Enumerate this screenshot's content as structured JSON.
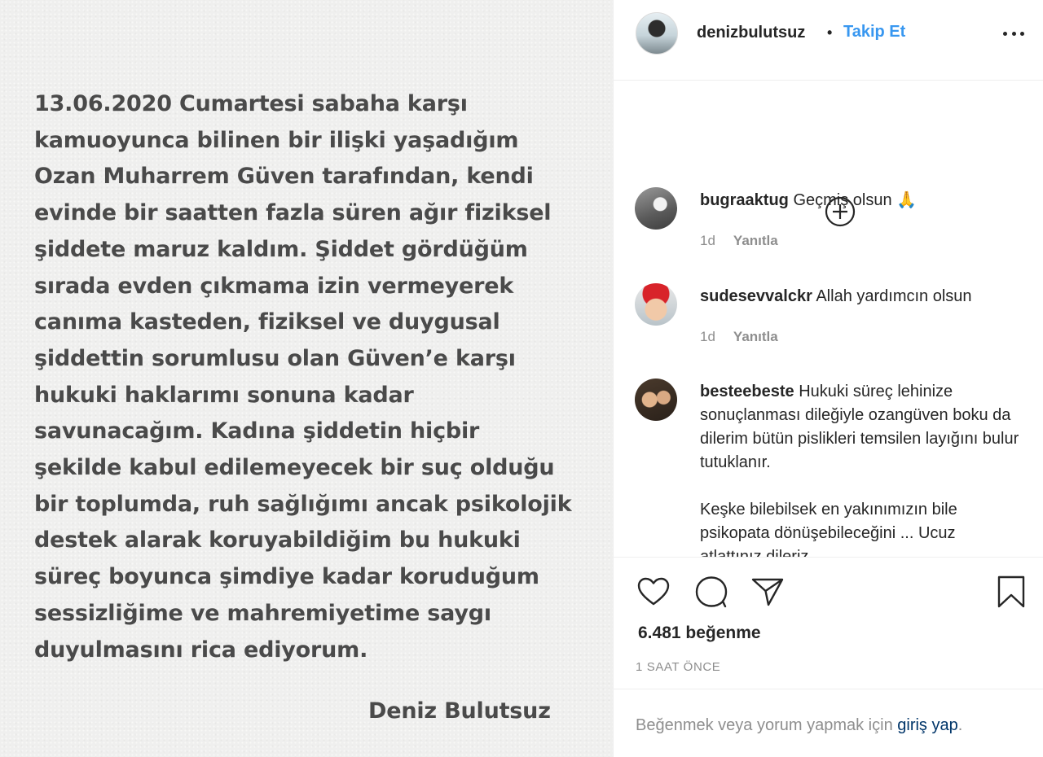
{
  "post": {
    "statement_lines": [
      "13.06.2020 Cumartesi sabaha karşı",
      "kamuoyunca bilinen bir ilişki yaşadığım",
      "Ozan Muharrem Güven tarafından, kendi",
      "evinde bir saatten fazla süren ağır fiziksel",
      "şiddete maruz kaldım. Şiddet gördüğüm",
      "sırada evden çıkmama izin vermeyerek",
      "canıma kasteden, fiziksel ve duygusal",
      "şiddettin sorumlusu olan Güven’e karşı",
      "hukuki haklarımı sonuna kadar",
      "savunacağım. Kadına şiddetin hiçbir",
      "şekilde kabul edilemeyecek bir suç olduğu",
      "bir toplumda, ruh sağlığımı ancak psikolojik",
      "destek alarak koruyabildiğim bu hukuki",
      "süreç boyunca şimdiye kadar koruduğum",
      "sessizliğime ve mahremiyetime saygı",
      "duyulmasını rica ediyorum."
    ],
    "signature": "Deniz Bulutsuz"
  },
  "header": {
    "username": "denizbulutsuz",
    "separator": "•",
    "follow_label": "Takip Et",
    "more_icon": "more-horizontal-icon"
  },
  "load_more_icon": "plus-circle-icon",
  "comments": [
    {
      "username": "bugraaktug",
      "text": "Geçmiş olsun 🙏",
      "age": "1d",
      "reply_label": "Yanıtla"
    },
    {
      "username": "sudesevvalckr",
      "text": "Allah yardımcın olsun",
      "age": "1d",
      "reply_label": "Yanıtla"
    },
    {
      "username": "besteebeste",
      "text": "Hukuki süreç lehinize sonuçlanması dileğiyle ozangüven boku da dilerim bütün pislikleri temsilen layığını bulur tutuklanır.",
      "text_more": "Keşke bilebilsek en yakınımızın bile psikopata dönüşebileceğini ... Ucuz atlattınız dileriz"
    }
  ],
  "actions": {
    "like_icon": "heart-icon",
    "comment_icon": "comment-icon",
    "share_icon": "share-icon",
    "save_icon": "bookmark-icon",
    "likes_text": "6.481 beğenme",
    "timestamp": "1 SAAT ÖNCE"
  },
  "footer": {
    "prompt_text": "Beğenmek veya yorum yapmak için",
    "login_link": "giriş yap",
    "end_punct": "."
  },
  "colors": {
    "accent": "#3897f0",
    "link": "#003569",
    "muted": "#8e8e8e",
    "text": "#262626",
    "image_text": "#4a4a4a"
  }
}
